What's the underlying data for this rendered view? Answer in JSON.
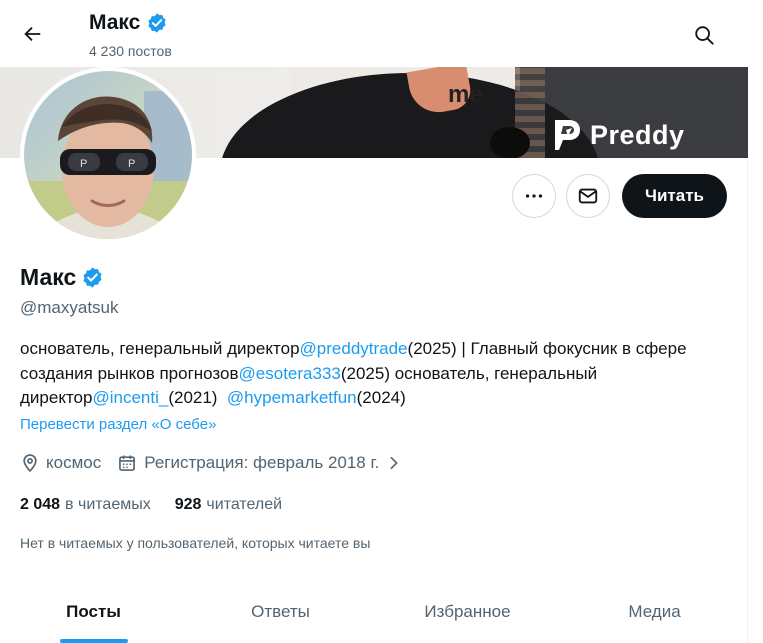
{
  "header": {
    "name": "Макс",
    "posts_count": "4 230 постов"
  },
  "banner": {
    "overlay_text": "me",
    "brand": "Preddy"
  },
  "actions": {
    "follow_label": "Читать"
  },
  "profile": {
    "name": "Макс",
    "handle": "@maxyatsuk",
    "bio": {
      "t1": "основатель, генеральный директор",
      "m1": "@preddytrade",
      "t2": "(2025) | Главный фокусник в сфере создания рынков прогнозов",
      "m2": "@esotera333",
      "t3": "(2025) основатель, генеральный директор",
      "m3": "@incenti_",
      "t4": "(2021)  ",
      "m4": "@hypemarketfun",
      "t5": "(2024)"
    },
    "translate_label": "Перевести раздел «О себе»",
    "location": "космос",
    "joined": "Регистрация: февраль 2018 г.",
    "following_count": "2 048",
    "following_label": "в читаемых",
    "followers_count": "928",
    "followers_label": "читателей",
    "not_followed_text": "Нет в читаемых у пользователей, которых читаете вы"
  },
  "tabs": [
    {
      "label": "Посты",
      "active": true
    },
    {
      "label": "Ответы",
      "active": false
    },
    {
      "label": "Избранное",
      "active": false
    },
    {
      "label": "Медиа",
      "active": false
    }
  ],
  "colors": {
    "accent": "#1d9bf0",
    "text": "#0f1419",
    "secondary": "#536471",
    "follow_button": "#0f1419"
  },
  "icons": {
    "back": "arrow-left-icon",
    "search": "search-icon",
    "verified": "verified-badge-icon",
    "more": "more-horizontal-icon",
    "message": "envelope-icon",
    "location": "location-pin-icon",
    "calendar": "calendar-icon",
    "chevron": "chevron-right-icon"
  }
}
